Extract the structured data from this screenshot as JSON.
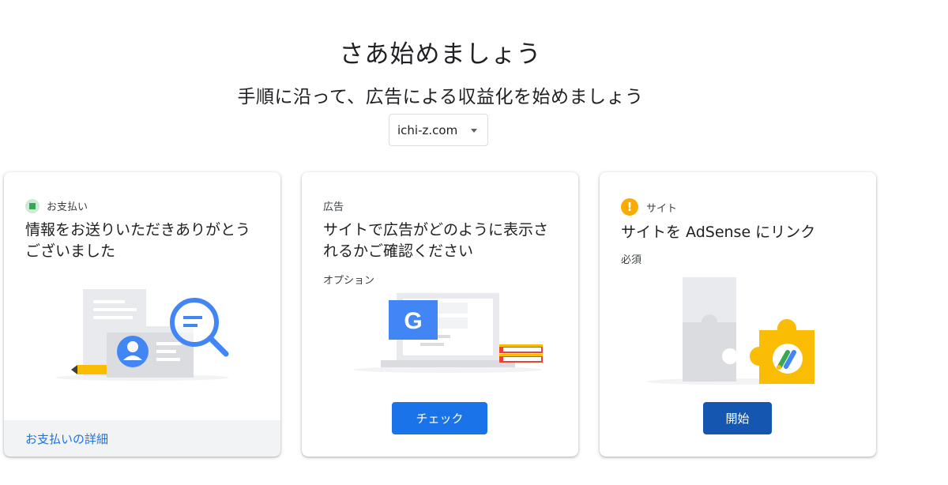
{
  "header": {
    "title": "さあ始めましょう",
    "subtitle": "手順に沿って、広告による収益化を始めましょう"
  },
  "site_selector": {
    "value": "ichi-z.com"
  },
  "cards": [
    {
      "tag": "お支払い",
      "heading": "情報をお送りいただきありがとうございました",
      "footer_link": "お支払いの詳細",
      "illustration": "payment-profile-illustration"
    },
    {
      "tag": "広告",
      "heading": "サイトで広告がどのように表示されるかご確認ください",
      "subtext": "オプション",
      "button": "チェック",
      "illustration": "ad-preview-illustration"
    },
    {
      "tag": "サイト",
      "heading": "サイトを AdSense にリンク",
      "subtext": "必須",
      "button": "開始",
      "illustration": "adsense-puzzle-illustration"
    }
  ],
  "icons": {
    "card1_tag": "check-square-icon",
    "card3_tag": "warning-icon",
    "select_caret": "caret-down-icon"
  },
  "colors": {
    "primary_blue": "#1a73e8",
    "dark_blue_button": "#1557b0",
    "warning": "#f9ab00",
    "success": "#34a853",
    "google_yellow": "#fbbc04"
  }
}
